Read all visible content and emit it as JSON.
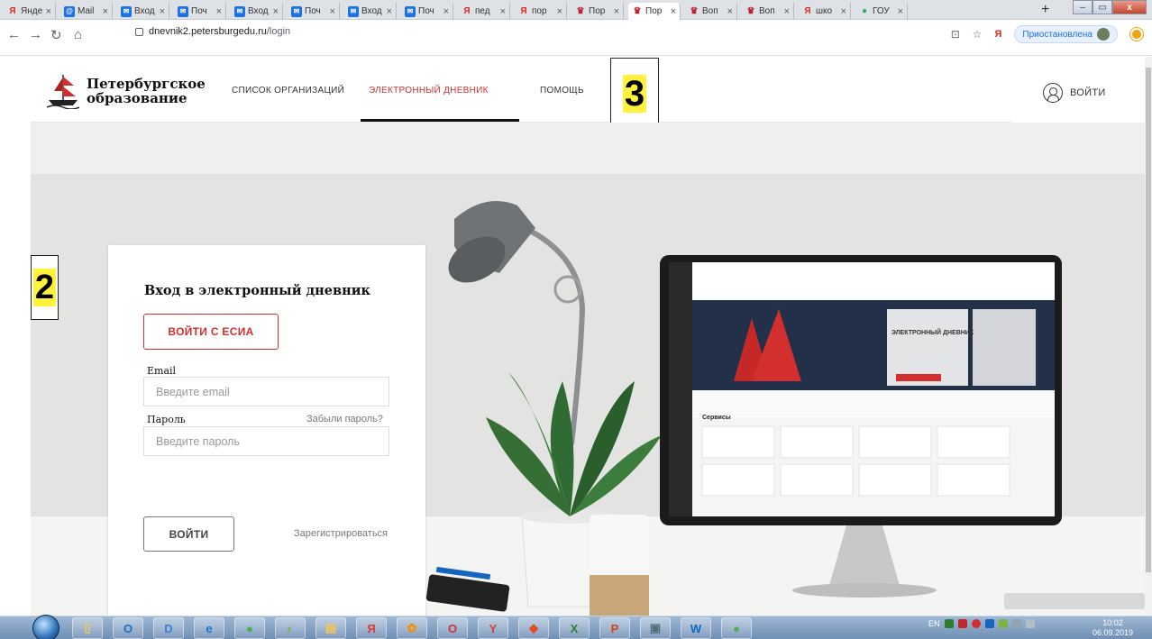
{
  "browser": {
    "tabs": [
      {
        "label": "Янде",
        "icon": "yandex-icon"
      },
      {
        "label": "Mail",
        "icon": "mail-icon"
      },
      {
        "label": "Вход",
        "icon": "gmail-icon"
      },
      {
        "label": "Поч",
        "icon": "gmail-icon"
      },
      {
        "label": "Вход",
        "icon": "gmail-icon"
      },
      {
        "label": "Поч",
        "icon": "gmail-icon"
      },
      {
        "label": "Вход",
        "icon": "gmail-icon"
      },
      {
        "label": "Поч",
        "icon": "gmail-icon"
      },
      {
        "label": "пед",
        "icon": "yandex-icon"
      },
      {
        "label": "пор",
        "icon": "yandex-icon"
      },
      {
        "label": "Пор",
        "icon": "emblem-icon"
      },
      {
        "label": "Пор",
        "icon": "emblem-icon"
      },
      {
        "label": "Воп",
        "icon": "emblem-icon"
      },
      {
        "label": "Воп",
        "icon": "emblem-icon"
      },
      {
        "label": "шко",
        "icon": "yandex-icon"
      },
      {
        "label": "ГОУ",
        "icon": "globe-icon"
      }
    ],
    "active_tab_index": 11,
    "close_glyph": "×",
    "new_tab_glyph": "+",
    "url_host": "dnevnik2.petersburgedu.ru",
    "url_path": "/login",
    "paused_label": "Приостановлена",
    "yandex_glyph": "Я"
  },
  "site": {
    "logo_line1": "Петербургское",
    "logo_line2": "образование",
    "nav": {
      "organizations": "СПИСОК ОРГАНИЗАЦИЙ",
      "diary": "ЭЛЕКТРОННЫЙ ДНЕВНИК",
      "help": "ПОМОЩЬ"
    },
    "login_link": "ВОЙТИ"
  },
  "callouts": {
    "three": "3",
    "two": "2"
  },
  "login": {
    "title": "Вход в электронный дневник",
    "esia_button": "ВОЙТИ С ЕСИА",
    "email_label": "Email",
    "email_placeholder": "Введите email",
    "password_label": "Пароль",
    "forgot_link": "Забыли пароль?",
    "password_placeholder": "Введите пароль",
    "submit_button": "ВОЙТИ",
    "register_link": "Зарегистрироваться"
  },
  "screen_mock": {
    "banner_title": "ЭЛЕКТРОННЫЙ ДНЕВНИК",
    "services_heading": "Сервисы"
  },
  "taskbar": {
    "apps": [
      "explorer-icon",
      "outlook-icon",
      "media-icon",
      "ie-icon",
      "chrome-icon",
      "app-icon",
      "folder-icon",
      "yandex-icon",
      "app2-icon",
      "opera-icon",
      "yandex-browser-icon",
      "anydesk-icon",
      "excel-icon",
      "powerpoint-icon",
      "app3-icon",
      "word-icon",
      "chrome2-icon"
    ],
    "lang": "EN",
    "time": "10:02",
    "date": "06.09.2019"
  },
  "colors": {
    "accent_red": "#d32f2f",
    "highlight_yellow": "#fff23b"
  }
}
